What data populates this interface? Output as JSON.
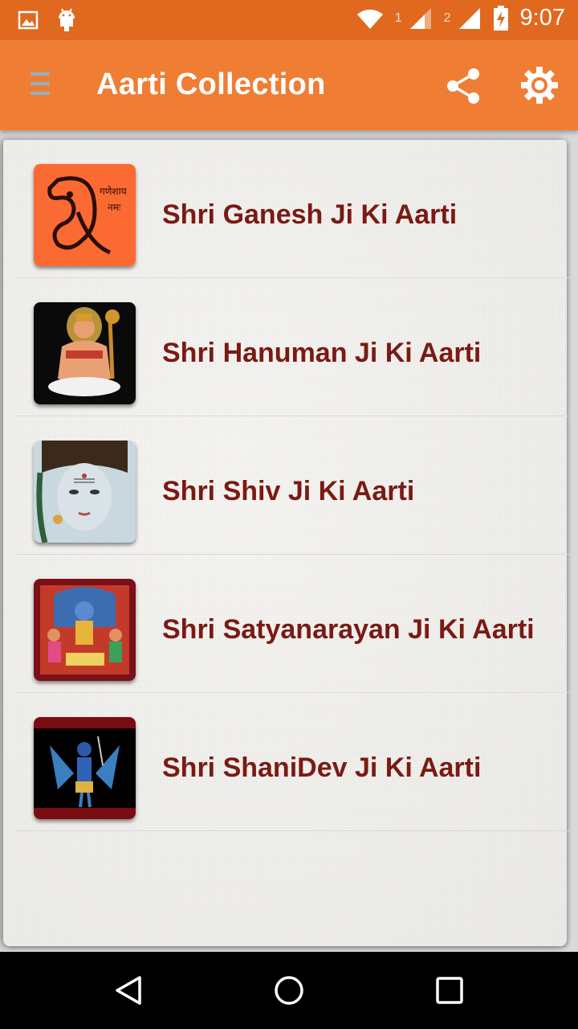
{
  "status_bar": {
    "time": "9:07",
    "sim1_label": "1",
    "sim2_label": "2",
    "icons": [
      "gallery-icon",
      "android-icon",
      "wifi-icon",
      "signal-icon",
      "signal-icon",
      "battery-charging-icon"
    ]
  },
  "app_bar": {
    "title": "Aarti Collection",
    "icons": [
      "menu-icon",
      "share-icon",
      "gear-icon"
    ]
  },
  "aarti_list": [
    {
      "label": "Shri Ganesh Ji Ki Aarti",
      "thumb_icon": "ganesh-image"
    },
    {
      "label": "Shri Hanuman Ji Ki Aarti",
      "thumb_icon": "hanuman-image"
    },
    {
      "label": "Shri Shiv Ji Ki Aarti",
      "thumb_icon": "shiv-image"
    },
    {
      "label": "Shri Satyanarayan Ji Ki Aarti",
      "thumb_icon": "satyanarayan-image"
    },
    {
      "label": "Shri ShaniDev Ji Ki Aarti",
      "thumb_icon": "shanidev-image"
    }
  ],
  "nav_bar": {
    "icons": [
      "back-icon",
      "home-icon",
      "recents-icon"
    ]
  },
  "colors": {
    "status_bar": "#e0691f",
    "app_bar": "#f07d34",
    "item_text": "#7a1a14",
    "card_bg": "#f2f0ed"
  }
}
